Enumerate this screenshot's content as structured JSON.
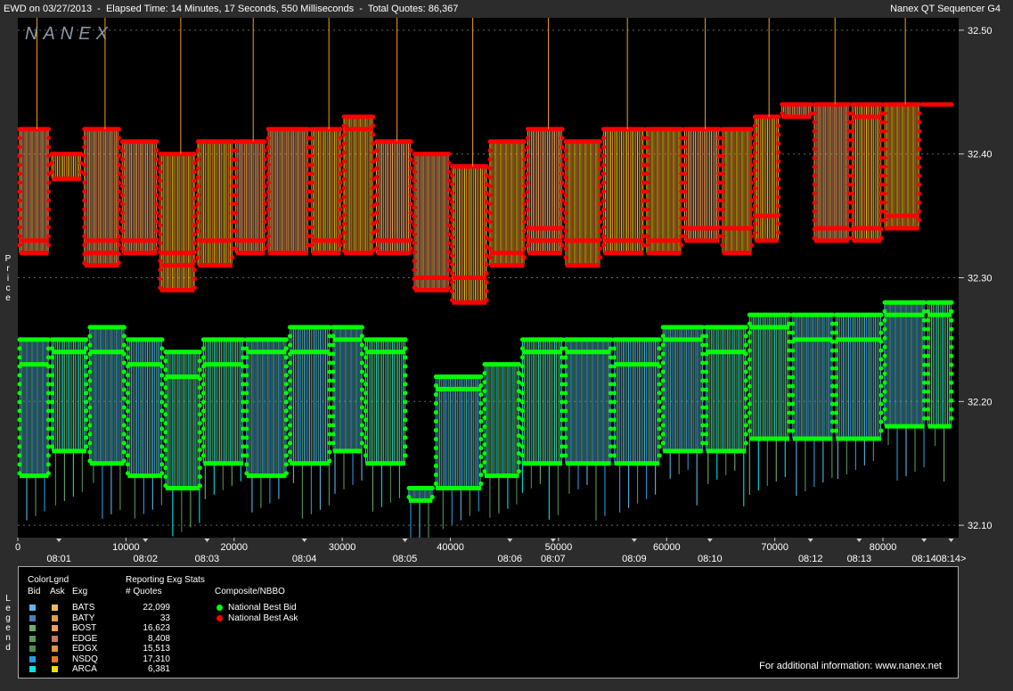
{
  "header": {
    "title": "EWD on 03/27/2013  -  Elapsed Time: 14 Minutes, 17 Seconds, 550 Milliseconds  -  Total Quotes: 86,367",
    "right": "Nanex QT Sequencer G4"
  },
  "watermark": "NANEX",
  "side_labels": {
    "price": "Price",
    "legend": "Legend"
  },
  "chart_data": {
    "type": "line",
    "y_ticks": [
      "32.50",
      "32.40",
      "32.30",
      "32.20",
      "32.10"
    ],
    "ylim": [
      32.09,
      32.51
    ],
    "xlim": [
      0,
      87000
    ],
    "x_ticks": [
      "0",
      "10000",
      "20000",
      "30000",
      "40000",
      "50000",
      "60000",
      "70000",
      "80000"
    ],
    "time_labels": [
      {
        "x": 3800,
        "label": "08:01"
      },
      {
        "x": 11800,
        "label": "08:02"
      },
      {
        "x": 17500,
        "label": "08:03"
      },
      {
        "x": 26500,
        "label": "08:04"
      },
      {
        "x": 35800,
        "label": "08:05"
      },
      {
        "x": 45500,
        "label": "08:06"
      },
      {
        "x": 49500,
        "label": "08:07"
      },
      {
        "x": 57000,
        "label": "08:09"
      },
      {
        "x": 64000,
        "label": "08:10"
      },
      {
        "x": 73300,
        "label": "08:12"
      },
      {
        "x": 77800,
        "label": "08:13"
      },
      {
        "x": 83800,
        "label": "08:14"
      },
      {
        "x": 86300,
        "label": "08:14>"
      }
    ],
    "series": [
      {
        "name": "National Best Ask",
        "color": "#ff0000",
        "segments": [
          {
            "x0": 0,
            "x1": 3000,
            "levels": [
              32.42,
              32.33,
              32.32
            ]
          },
          {
            "x0": 3000,
            "x1": 6000,
            "levels": [
              32.4,
              32.38
            ]
          },
          {
            "x0": 6000,
            "x1": 9500,
            "levels": [
              32.42,
              32.33,
              32.32,
              32.31
            ]
          },
          {
            "x0": 9500,
            "x1": 13000,
            "levels": [
              32.41,
              32.33,
              32.32
            ]
          },
          {
            "x0": 13000,
            "x1": 16500,
            "levels": [
              32.4,
              32.32,
              32.31,
              32.29
            ]
          },
          {
            "x0": 16500,
            "x1": 20000,
            "levels": [
              32.41,
              32.33,
              32.31
            ]
          },
          {
            "x0": 20000,
            "x1": 23000,
            "levels": [
              32.41,
              32.33,
              32.32
            ]
          },
          {
            "x0": 23000,
            "x1": 27000,
            "levels": [
              32.42,
              32.32
            ]
          },
          {
            "x0": 27000,
            "x1": 30000,
            "levels": [
              32.42,
              32.33,
              32.32
            ]
          },
          {
            "x0": 30000,
            "x1": 33000,
            "levels": [
              32.43,
              32.42,
              32.32
            ]
          },
          {
            "x0": 33000,
            "x1": 36500,
            "levels": [
              32.41,
              32.33,
              32.32
            ]
          },
          {
            "x0": 36500,
            "x1": 40000,
            "levels": [
              32.4,
              32.3,
              32.29
            ]
          },
          {
            "x0": 40000,
            "x1": 43500,
            "levels": [
              32.39,
              32.3,
              32.28
            ]
          },
          {
            "x0": 43500,
            "x1": 47000,
            "levels": [
              32.41,
              32.32,
              32.31
            ]
          },
          {
            "x0": 47000,
            "x1": 50500,
            "levels": [
              32.42,
              32.34,
              32.33,
              32.32
            ]
          },
          {
            "x0": 50500,
            "x1": 54000,
            "levels": [
              32.41,
              32.33,
              32.31
            ]
          },
          {
            "x0": 54000,
            "x1": 58000,
            "levels": [
              32.42,
              32.33,
              32.32
            ]
          },
          {
            "x0": 58000,
            "x1": 61500,
            "levels": [
              32.42,
              32.33,
              32.32
            ]
          },
          {
            "x0": 61500,
            "x1": 65000,
            "levels": [
              32.42,
              32.34,
              32.33
            ]
          },
          {
            "x0": 65000,
            "x1": 68000,
            "levels": [
              32.42,
              32.34,
              32.32
            ]
          },
          {
            "x0": 68000,
            "x1": 70500,
            "levels": [
              32.43,
              32.35,
              32.33
            ]
          },
          {
            "x0": 70500,
            "x1": 73500,
            "levels": [
              32.44,
              32.43
            ]
          },
          {
            "x0": 73500,
            "x1": 77000,
            "levels": [
              32.44,
              32.34,
              32.33
            ]
          },
          {
            "x0": 77000,
            "x1": 80000,
            "levels": [
              32.44,
              32.43,
              32.34,
              32.33
            ]
          },
          {
            "x0": 80000,
            "x1": 83500,
            "levels": [
              32.44,
              32.35,
              32.34
            ]
          },
          {
            "x0": 83500,
            "x1": 86500,
            "levels": [
              32.44
            ]
          }
        ]
      },
      {
        "name": "National Best Bid",
        "color": "#00ff00",
        "segments": [
          {
            "x0": 0,
            "x1": 3000,
            "levels": [
              32.25,
              32.23,
              32.14
            ]
          },
          {
            "x0": 3000,
            "x1": 6500,
            "levels": [
              32.25,
              32.24,
              32.16
            ]
          },
          {
            "x0": 6500,
            "x1": 10000,
            "levels": [
              32.26,
              32.24,
              32.15
            ]
          },
          {
            "x0": 10000,
            "x1": 13500,
            "levels": [
              32.25,
              32.23,
              32.14
            ]
          },
          {
            "x0": 13500,
            "x1": 17000,
            "levels": [
              32.24,
              32.22,
              32.13
            ]
          },
          {
            "x0": 17000,
            "x1": 21000,
            "levels": [
              32.25,
              32.23,
              32.15
            ]
          },
          {
            "x0": 21000,
            "x1": 25000,
            "levels": [
              32.25,
              32.24,
              32.14
            ]
          },
          {
            "x0": 25000,
            "x1": 29000,
            "levels": [
              32.26,
              32.24,
              32.15
            ]
          },
          {
            "x0": 29000,
            "x1": 32000,
            "levels": [
              32.26,
              32.25,
              32.16
            ]
          },
          {
            "x0": 32000,
            "x1": 36000,
            "levels": [
              32.25,
              32.24,
              32.15
            ]
          },
          {
            "x0": 36000,
            "x1": 38500,
            "levels": [
              32.13,
              32.12
            ]
          },
          {
            "x0": 38500,
            "x1": 43000,
            "levels": [
              32.22,
              32.21,
              32.13
            ]
          },
          {
            "x0": 43000,
            "x1": 46500,
            "levels": [
              32.23,
              32.14
            ]
          },
          {
            "x0": 46500,
            "x1": 50500,
            "levels": [
              32.25,
              32.24,
              32.15
            ]
          },
          {
            "x0": 50500,
            "x1": 55000,
            "levels": [
              32.25,
              32.24,
              32.15
            ]
          },
          {
            "x0": 55000,
            "x1": 59500,
            "levels": [
              32.25,
              32.23,
              32.15
            ]
          },
          {
            "x0": 59500,
            "x1": 63500,
            "levels": [
              32.26,
              32.25,
              32.16
            ]
          },
          {
            "x0": 63500,
            "x1": 67500,
            "levels": [
              32.26,
              32.24,
              32.16
            ]
          },
          {
            "x0": 67500,
            "x1": 71500,
            "levels": [
              32.27,
              32.26,
              32.17
            ]
          },
          {
            "x0": 71500,
            "x1": 75500,
            "levels": [
              32.27,
              32.25,
              32.17
            ]
          },
          {
            "x0": 75500,
            "x1": 80000,
            "levels": [
              32.27,
              32.25,
              32.17
            ]
          },
          {
            "x0": 80000,
            "x1": 84000,
            "levels": [
              32.28,
              32.27,
              32.18
            ]
          },
          {
            "x0": 84000,
            "x1": 86500,
            "levels": [
              32.28,
              32.27,
              32.18
            ]
          }
        ]
      }
    ]
  },
  "legend": {
    "colorlgnd": "ColorLgnd",
    "col_bid": "Bid",
    "col_ask": "Ask",
    "col_exg": "Exg",
    "reporting": "Reporting Exg Stats",
    "quotes_hdr": "# Quotes",
    "composite": "Composite/NBBO",
    "exchanges": [
      {
        "name": "BATS",
        "quotes": "22,099",
        "bid_color": "#5fb7e8",
        "ask_color": "#f4b860"
      },
      {
        "name": "BATY",
        "quotes": "33",
        "bid_color": "#4a7fb0",
        "ask_color": "#e39a4a"
      },
      {
        "name": "BOST",
        "quotes": "16,623",
        "bid_color": "#6fae6a",
        "ask_color": "#f0a050"
      },
      {
        "name": "EDGE",
        "quotes": "8,408",
        "bid_color": "#5a9a5a",
        "ask_color": "#c87860"
      },
      {
        "name": "EDGX",
        "quotes": "15,513",
        "bid_color": "#4f8f4f",
        "ask_color": "#e8903c"
      },
      {
        "name": "NSDQ",
        "quotes": "17,310",
        "bid_color": "#2a9ae0",
        "ask_color": "#e07a2a"
      },
      {
        "name": "ARCA",
        "quotes": "6,381",
        "bid_color": "#00e5e5",
        "ask_color": "#f0e000"
      }
    ],
    "nbbo": [
      {
        "label": "National Best Bid",
        "color": "#00ff00"
      },
      {
        "label": "National Best Ask",
        "color": "#ff0000"
      }
    ],
    "footer": "For additional information: www.nanex.net"
  }
}
